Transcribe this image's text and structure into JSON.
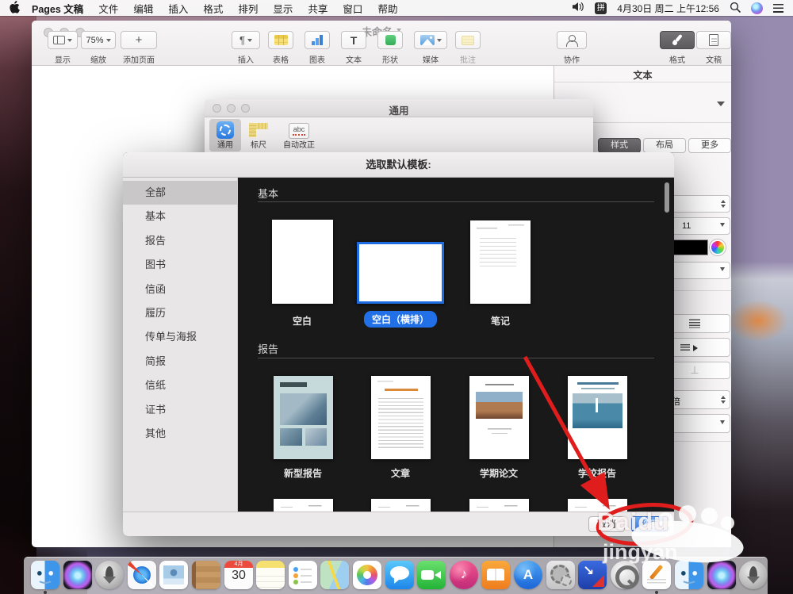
{
  "menubar": {
    "items": [
      "Pages 文稿",
      "文件",
      "编辑",
      "插入",
      "格式",
      "排列",
      "显示",
      "共享",
      "窗口",
      "帮助"
    ],
    "input_badge": "拼",
    "clock": "4月30日 周二 上午12:56"
  },
  "pages_window": {
    "title": "未命名",
    "toolbar": {
      "view": "显示",
      "zoom": "缩放",
      "zoom_value": "75%",
      "add_page": "添加页面",
      "insert": "插入",
      "table": "表格",
      "chart": "图表",
      "text": "文本",
      "shape": "形状",
      "media": "媒体",
      "comment": "批注",
      "collaborate": "协作",
      "format": "格式",
      "document": "文稿"
    },
    "format_panel": {
      "header": "文本",
      "tabs": [
        "样式",
        "布局",
        "更多"
      ],
      "font_size": "11",
      "line_spacing_unit": "倍"
    }
  },
  "prefs_window": {
    "title": "通用",
    "tabs": [
      "通用",
      "标尺",
      "自动改正"
    ],
    "autocorrect_icon_text": "abc"
  },
  "template_dialog": {
    "title": "选取默认模板:",
    "sidebar": [
      "全部",
      "基本",
      "报告",
      "图书",
      "信函",
      "履历",
      "传单与海报",
      "简报",
      "信纸",
      "证书",
      "其他"
    ],
    "section1": "基本",
    "section2": "报告",
    "templates_basic": [
      "空白",
      "空白（横排）",
      "笔记"
    ],
    "templates_report": [
      "新型报告",
      "文章",
      "学期论文",
      "学校报告"
    ],
    "cancel": "取消",
    "choose": "选取"
  },
  "watermark": {
    "line1": "Baidu",
    "line2": "jingyan"
  },
  "dock": {
    "calendar_month": "4月",
    "calendar_day": "30",
    "icons": [
      "finder",
      "siri",
      "launchpad",
      "safari",
      "mail",
      "contacts",
      "calendar",
      "notes",
      "reminders",
      "maps",
      "photos",
      "messages",
      "facetime",
      "itunes",
      "ibooks",
      "app-store",
      "system-preferences",
      "remote-app",
      "quicktime",
      "pages",
      "finder-alt",
      "siri-alt",
      "rocket"
    ]
  },
  "colors": {
    "accent_blue": "#2270e8",
    "annotation_red": "#e01d1d",
    "dialog_dark": "#1a1a1a"
  }
}
